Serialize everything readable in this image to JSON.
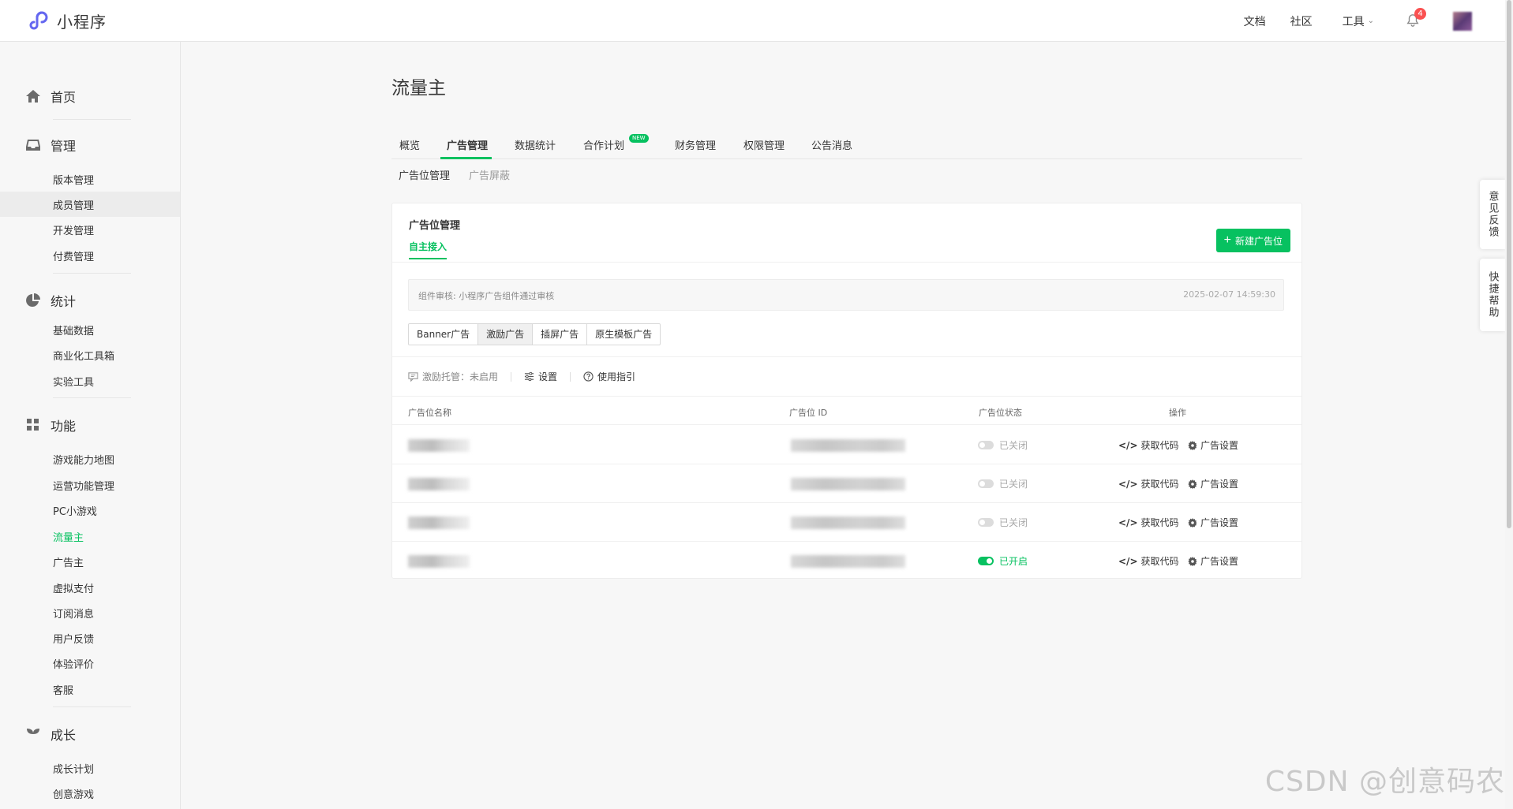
{
  "header": {
    "logo_text": "小程序",
    "links": [
      "文档",
      "社区"
    ],
    "tools_label": "工具",
    "notification_count": "4"
  },
  "sidebar": {
    "sections": [
      {
        "label": "首页",
        "icon": "home-icon"
      },
      {
        "label": "管理",
        "icon": "inbox-icon",
        "items": [
          "版本管理",
          "成员管理",
          "开发管理",
          "付费管理"
        ]
      },
      {
        "label": "统计",
        "icon": "pie-chart-icon",
        "items": [
          "基础数据",
          "商业化工具箱",
          "实验工具"
        ]
      },
      {
        "label": "功能",
        "icon": "grid-icon",
        "items": [
          "游戏能力地图",
          "运营功能管理",
          "PC小游戏",
          "流量主",
          "广告主",
          "虚拟支付",
          "订阅消息",
          "用户反馈",
          "体验评价",
          "客服"
        ]
      },
      {
        "label": "成长",
        "icon": "sprout-icon",
        "items": [
          "成长计划",
          "创意游戏"
        ]
      }
    ],
    "highlighted_item": "成员管理",
    "active_item": "流量主"
  },
  "page": {
    "title": "流量主",
    "tabs": [
      "概览",
      "广告管理",
      "数据统计",
      "合作计划",
      "财务管理",
      "权限管理",
      "公告消息"
    ],
    "active_tab": "广告管理",
    "new_badge": "NEW",
    "subtabs": [
      "广告位管理",
      "广告屏蔽"
    ]
  },
  "card": {
    "title": "广告位管理",
    "tab": "自主接入",
    "new_button": "新建广告位",
    "notice_text": "组件审核: 小程序广告组件通过审核",
    "notice_time": "2025-02-07 14:59:30",
    "ad_types": [
      "Banner广告",
      "激励广告",
      "插屏广告",
      "原生模板广告"
    ],
    "selected_ad_type": "激励广告",
    "options": {
      "hosting": "激励托管：未启用",
      "settings": "设置",
      "guide": "使用指引"
    },
    "table": {
      "columns": [
        "广告位名称",
        "广告位 ID",
        "广告位状态",
        "操作"
      ],
      "rows": [
        {
          "status": "已关闭",
          "on": false
        },
        {
          "status": "已关闭",
          "on": false
        },
        {
          "status": "已关闭",
          "on": false
        },
        {
          "status": "已开启",
          "on": true
        }
      ],
      "action_code": "获取代码",
      "action_settings": "广告设置"
    }
  },
  "float": {
    "feedback": "意见反馈",
    "help": "快捷帮助"
  },
  "watermark": "CSDN @创意码农",
  "colors": {
    "accent": "#07c160",
    "badge": "#fa5151"
  }
}
